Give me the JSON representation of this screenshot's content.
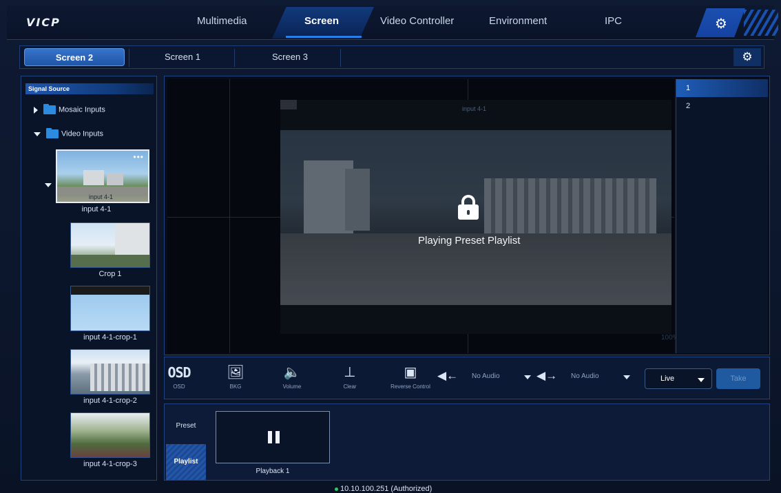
{
  "app": {
    "logo": "VICP"
  },
  "nav": {
    "items": [
      {
        "label": "Multimedia"
      },
      {
        "label": "Screen",
        "active": true
      },
      {
        "label": "Video Controller"
      },
      {
        "label": "Environment"
      },
      {
        "label": "IPC"
      }
    ],
    "settings_icon": "gear-icon"
  },
  "screen_tabs": [
    {
      "label": "Screen 2",
      "active": true
    },
    {
      "label": "Screen 1"
    },
    {
      "label": "Screen 3"
    }
  ],
  "signal_source": {
    "title": "Signal Source",
    "groups": [
      {
        "label": "Mosaic Inputs",
        "expanded": false
      },
      {
        "label": "Video Inputs",
        "expanded": true
      }
    ],
    "inputs": [
      {
        "caption": "input 4-1",
        "overlay": "input 4-1"
      },
      {
        "caption": "Crop 1"
      },
      {
        "caption": "input 4-1-crop-1"
      },
      {
        "caption": "input 4-1-crop-2"
      },
      {
        "caption": "input 4-1-crop-3"
      }
    ]
  },
  "preview": {
    "window_label": "input 4-1",
    "lock_message": "Playing Preset Playlist",
    "zoom": "100%"
  },
  "layers": [
    {
      "label": "1",
      "active": true
    },
    {
      "label": "2"
    }
  ],
  "toolbar": {
    "osd": {
      "icon": "OSD",
      "label": "OSD"
    },
    "bkg": {
      "label": "BKG"
    },
    "volume": {
      "label": "Volume"
    },
    "clear": {
      "label": "Clear"
    },
    "reverse": {
      "label": "Reverse Control"
    },
    "audio_in": {
      "value": "No Audio"
    },
    "audio_out": {
      "value": "No Audio"
    },
    "mode": {
      "value": "Live"
    },
    "take": {
      "label": "Take"
    }
  },
  "playlist": {
    "side_tabs": [
      {
        "label": "Preset"
      },
      {
        "label": "Playlist",
        "active": true
      }
    ],
    "items": [
      {
        "label": "Playback 1",
        "state": "paused"
      }
    ]
  },
  "status": {
    "text": "10.10.100.251 (Authorized)",
    "color": "#2fc76a"
  },
  "colors": {
    "accent": "#1f5aa0",
    "active_tab": "#3673c9",
    "background": "#0a1326"
  }
}
